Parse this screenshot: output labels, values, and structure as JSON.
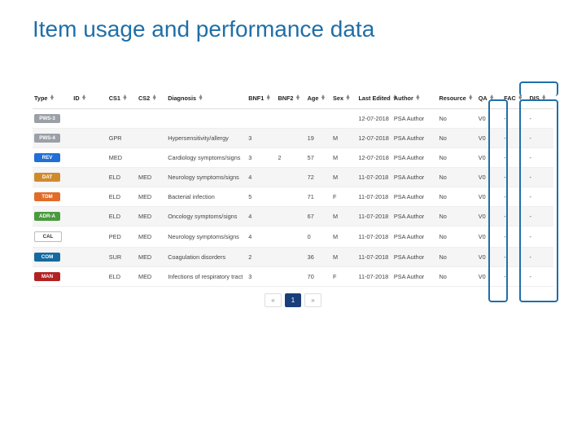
{
  "title": "Item usage and performance data",
  "headers": {
    "type": "Type",
    "id": "ID",
    "cs1": "CS1",
    "cs2": "CS2",
    "diagnosis": "Diagnosis",
    "bnf1": "BNF1",
    "bnf2": "BNF2",
    "age": "Age",
    "sex": "Sex",
    "last_edited": "Last Edited",
    "author": "Author",
    "resource": "Resource",
    "qa": "QA",
    "fac": "FAC",
    "dis": "DIS"
  },
  "rows": [
    {
      "type": "PWS-3",
      "badge": "b-pws3",
      "id": "",
      "cs1": "",
      "cs2": "",
      "diagnosis": "",
      "bnf1": "",
      "bnf2": "",
      "age": "",
      "sex": "",
      "last": "12-07-2018",
      "author": "PSA Author",
      "resource": "No",
      "qa": "V0",
      "fac": "-",
      "dis": "-"
    },
    {
      "type": "PWS-4",
      "badge": "b-pws4",
      "id": "",
      "cs1": "GPR",
      "cs2": "",
      "diagnosis": "Hypersensitivity/allergy",
      "bnf1": "3",
      "bnf2": "",
      "age": "19",
      "sex": "M",
      "last": "12-07-2018",
      "author": "PSA Author",
      "resource": "No",
      "qa": "V0",
      "fac": "-",
      "dis": "-"
    },
    {
      "type": "REV",
      "badge": "b-rev",
      "id": "",
      "cs1": "MED",
      "cs2": "",
      "diagnosis": "Cardiology symptoms/signs",
      "bnf1": "3",
      "bnf2": "2",
      "age": "57",
      "sex": "M",
      "last": "12-07-2018",
      "author": "PSA Author",
      "resource": "No",
      "qa": "V0",
      "fac": "-",
      "dis": "-"
    },
    {
      "type": "DAT",
      "badge": "b-dat",
      "id": "",
      "cs1": "ELD",
      "cs2": "MED",
      "diagnosis": "Neurology symptoms/signs",
      "bnf1": "4",
      "bnf2": "",
      "age": "72",
      "sex": "M",
      "last": "11-07-2018",
      "author": "PSA Author",
      "resource": "No",
      "qa": "V0",
      "fac": "-",
      "dis": "-"
    },
    {
      "type": "TDM",
      "badge": "b-tdm",
      "id": "",
      "cs1": "ELD",
      "cs2": "MED",
      "diagnosis": "Bacterial infection",
      "bnf1": "5",
      "bnf2": "",
      "age": "71",
      "sex": "F",
      "last": "11-07-2018",
      "author": "PSA Author",
      "resource": "No",
      "qa": "V0",
      "fac": "-",
      "dis": "-"
    },
    {
      "type": "ADR-A",
      "badge": "b-adra",
      "id": "",
      "cs1": "ELD",
      "cs2": "MED",
      "diagnosis": "Oncology symptoms/signs",
      "bnf1": "4",
      "bnf2": "",
      "age": "67",
      "sex": "M",
      "last": "11-07-2018",
      "author": "PSA Author",
      "resource": "No",
      "qa": "V0",
      "fac": "-",
      "dis": "-"
    },
    {
      "type": "CAL",
      "badge": "b-cal",
      "id": "",
      "cs1": "PED",
      "cs2": "MED",
      "diagnosis": "Neurology symptoms/signs",
      "bnf1": "4",
      "bnf2": "",
      "age": "0",
      "sex": "M",
      "last": "11-07-2018",
      "author": "PSA Author",
      "resource": "No",
      "qa": "V0",
      "fac": "-",
      "dis": "-"
    },
    {
      "type": "COM",
      "badge": "b-com",
      "id": "",
      "cs1": "SUR",
      "cs2": "MED",
      "diagnosis": "Coagulation disorders",
      "bnf1": "2",
      "bnf2": "",
      "age": "36",
      "sex": "M",
      "last": "11-07-2018",
      "author": "PSA Author",
      "resource": "No",
      "qa": "V0",
      "fac": "-",
      "dis": "-"
    },
    {
      "type": "MAN",
      "badge": "b-man",
      "id": "",
      "cs1": "ELD",
      "cs2": "MED",
      "diagnosis": "Infections of respiratory tract",
      "bnf1": "3",
      "bnf2": "",
      "age": "70",
      "sex": "F",
      "last": "11-07-2018",
      "author": "PSA Author",
      "resource": "No",
      "qa": "V0",
      "fac": "-",
      "dis": "-"
    }
  ],
  "pager": {
    "prev": "«",
    "page": "1",
    "next": "»"
  }
}
